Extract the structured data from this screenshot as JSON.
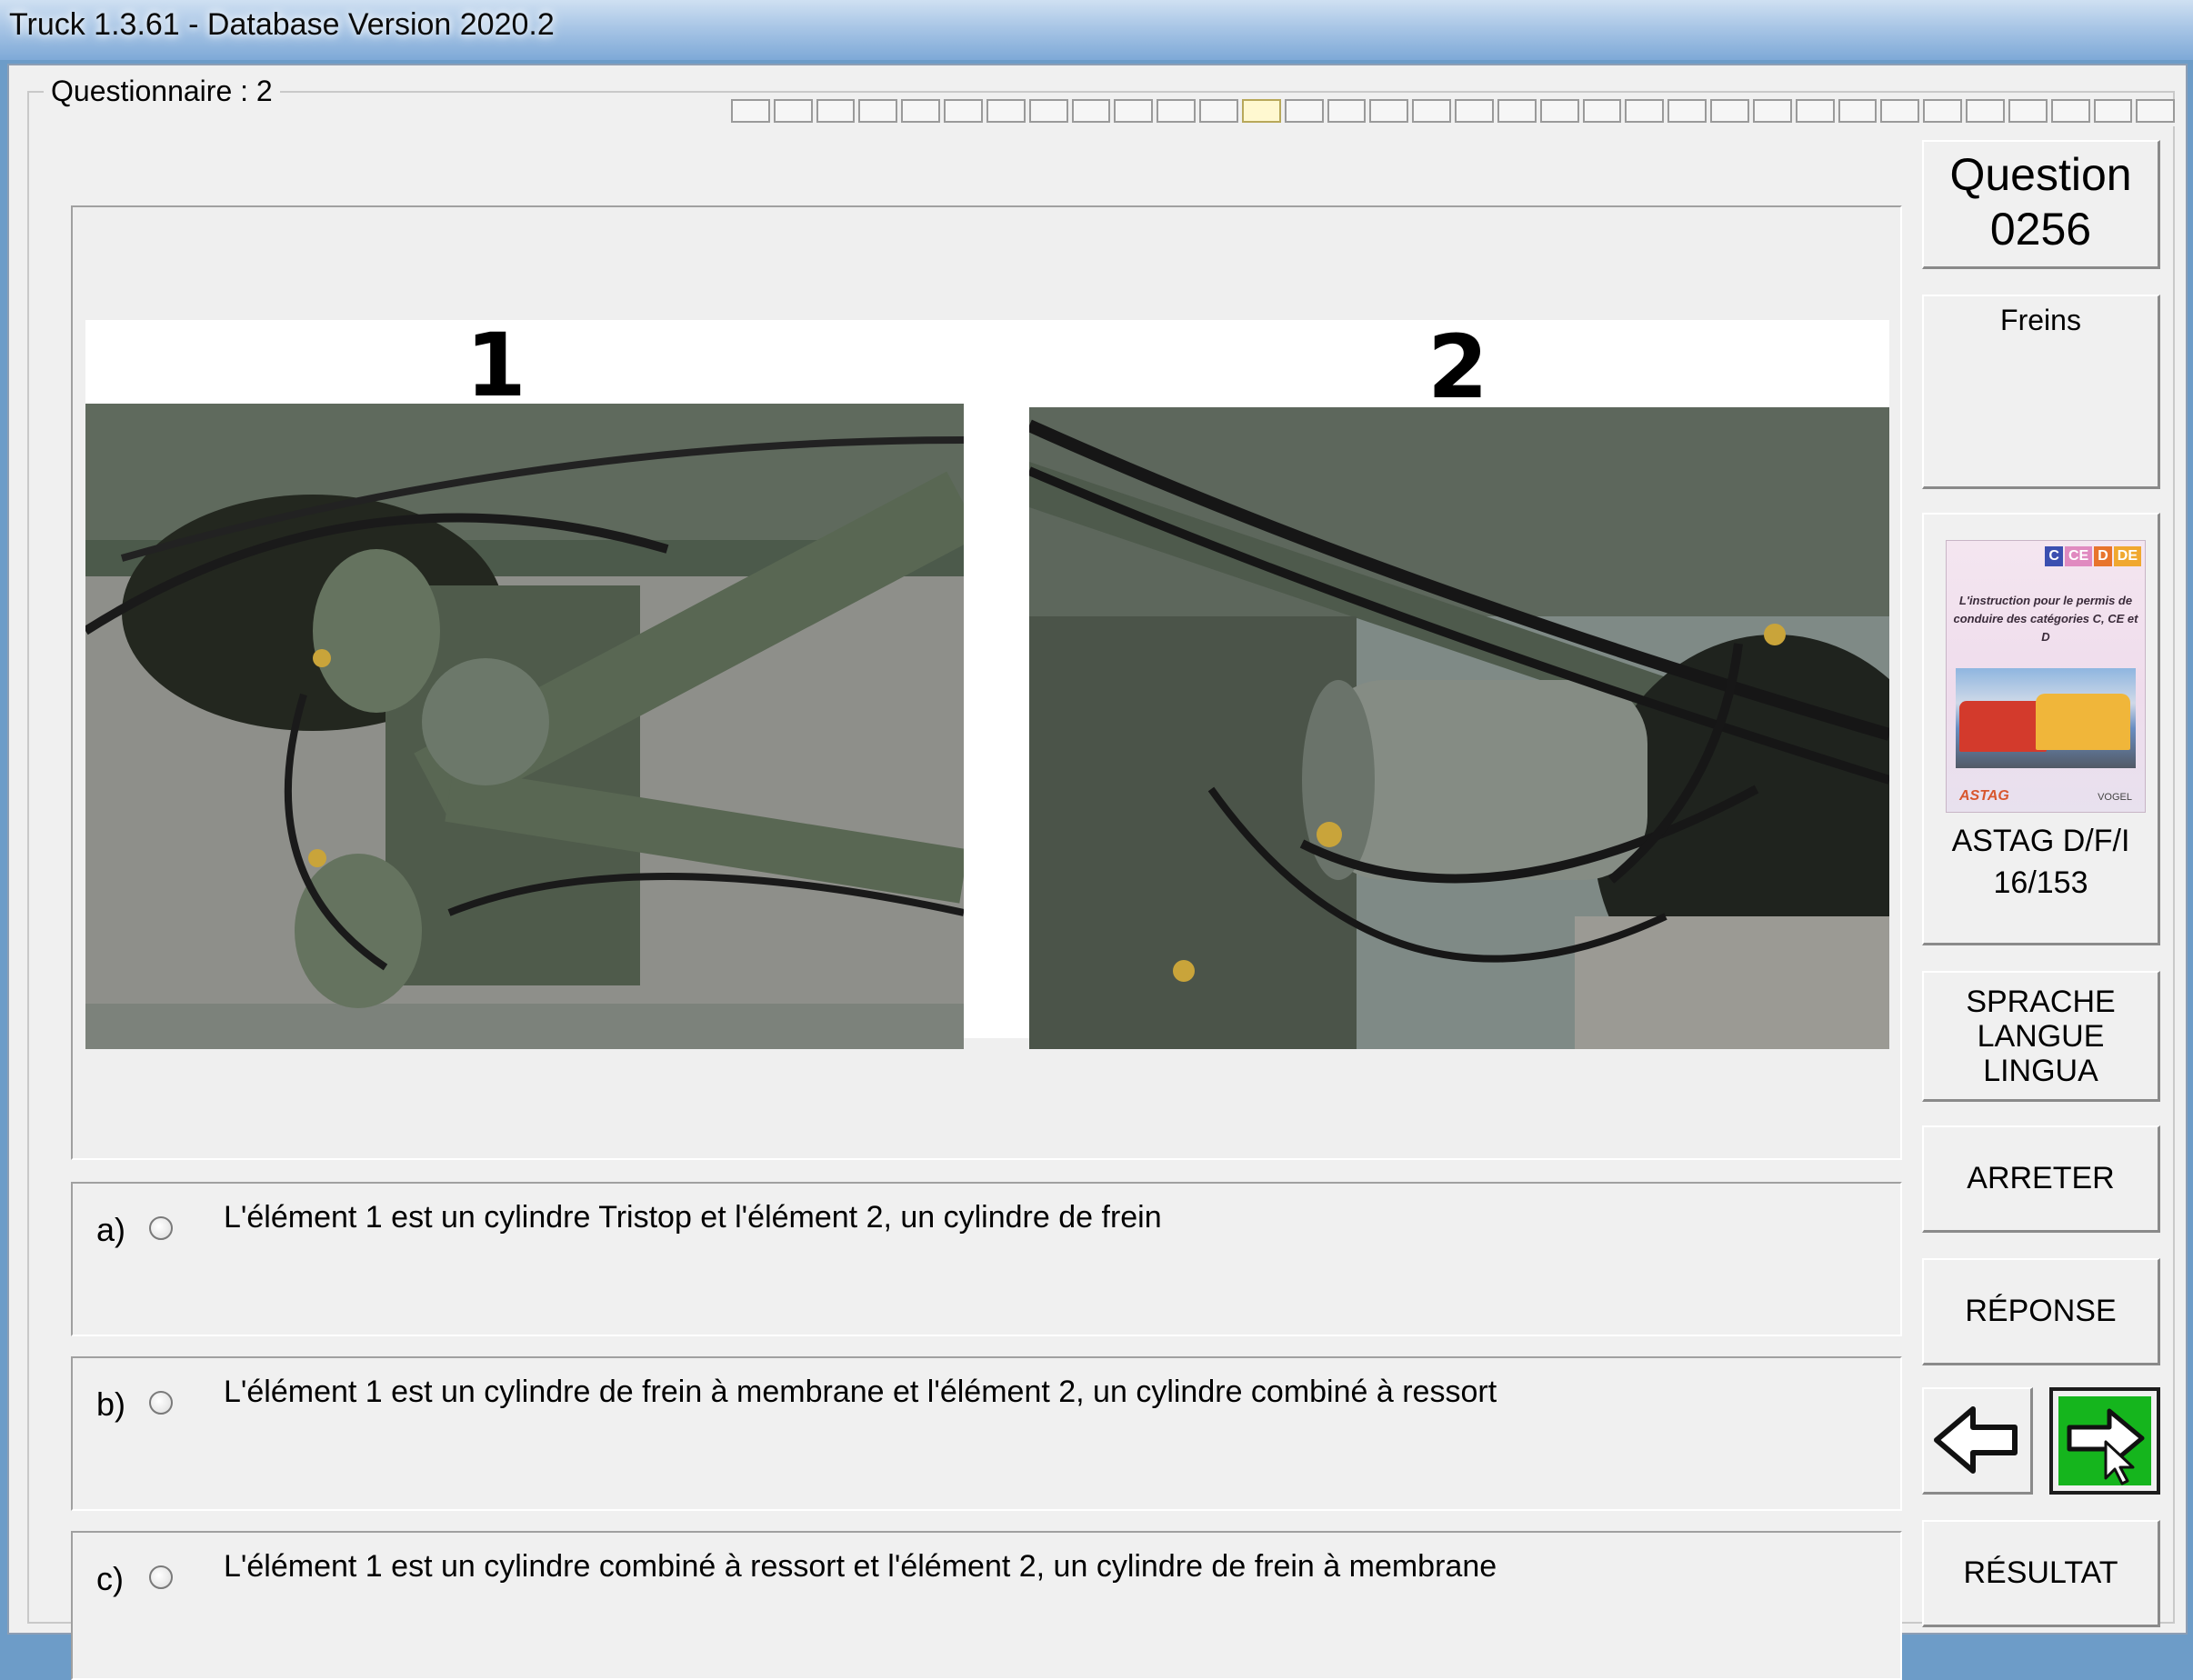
{
  "window": {
    "title": "Truck 1.3.61 - Database Version 2020.2"
  },
  "questionnaire": {
    "label": "Questionnaire : 2",
    "progress_segments": 34,
    "current_segment": 12
  },
  "images": {
    "labels": [
      "1",
      "2"
    ]
  },
  "answers": [
    {
      "letter": "a)",
      "text": "L'élément 1 est un cylindre Tristop et l'élément 2, un cylindre de frein",
      "selected": false
    },
    {
      "letter": "b)",
      "text": "L'élément 1 est un cylindre de frein à membrane et l'élément 2, un cylindre combiné à ressort",
      "selected": false
    },
    {
      "letter": "c)",
      "text": "L'élément 1 est un cylindre combiné à ressort et l'élément 2, un cylindre de frein à membrane",
      "selected": false
    }
  ],
  "sidebar": {
    "question_label": "Question",
    "question_number": "0256",
    "category": "Freins",
    "book": {
      "cats": [
        "C",
        "CE",
        "D",
        "DE"
      ],
      "text": "L'instruction pour le permis de conduire des catégories C, CE et D",
      "logo_left": "ASTAG",
      "logo_right": "VOGEL",
      "source": "ASTAG D/F/I",
      "page": "16/153"
    },
    "lang_lines": [
      "SPRACHE",
      "LANGUE",
      "LINGUA"
    ],
    "stop_label": "ARRETER",
    "answer_label": "RÉPONSE",
    "result_label": "RÉSULTAT",
    "prev_icon": "arrow-left-icon",
    "next_icon": "arrow-right-icon"
  },
  "colors": {
    "next_button_green": "#15b51d",
    "window_bg": "#f0f0f0"
  }
}
